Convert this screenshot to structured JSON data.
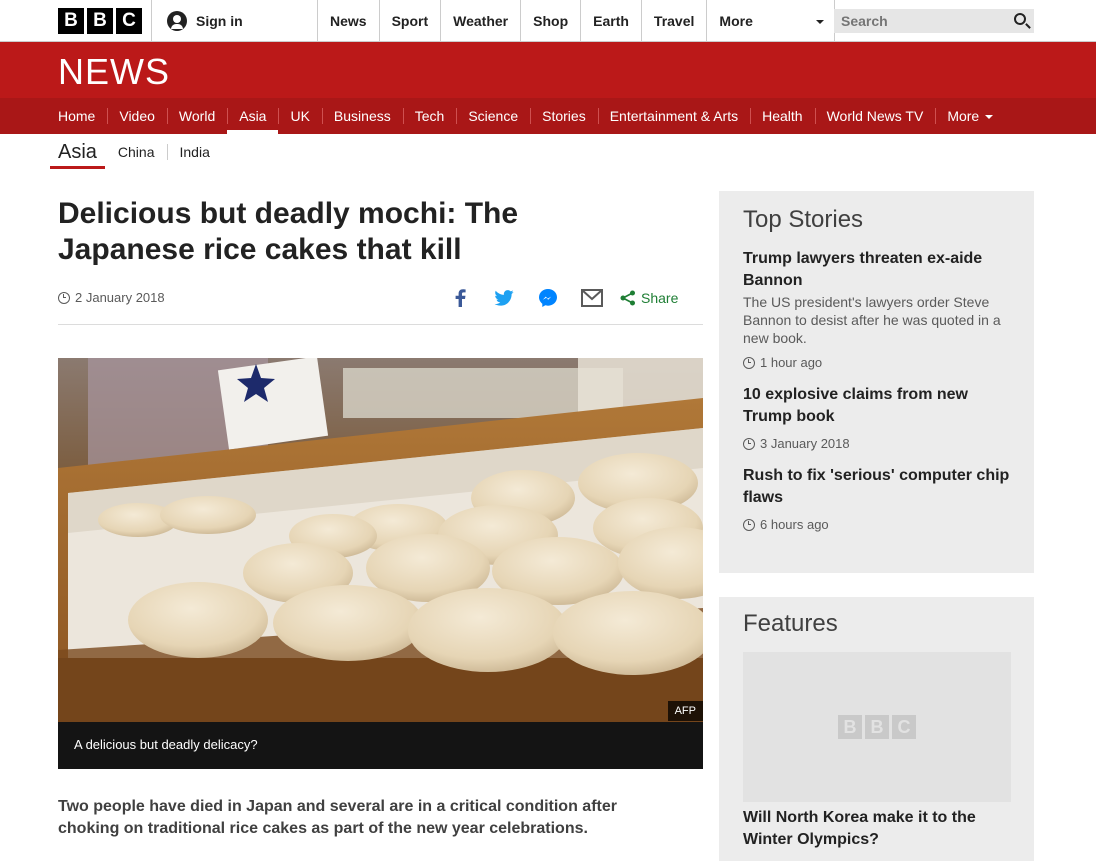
{
  "global": {
    "logo_letters": [
      "B",
      "B",
      "C"
    ],
    "sign_in": "Sign in",
    "nav": [
      "News",
      "Sport",
      "Weather",
      "Shop",
      "Earth",
      "Travel"
    ],
    "more": "More",
    "search_placeholder": "Search"
  },
  "masthead": {
    "wordmark": "NEWS",
    "color": "#bb1919"
  },
  "news_nav": {
    "items": [
      "Home",
      "Video",
      "World",
      "Asia",
      "UK",
      "Business",
      "Tech",
      "Science",
      "Stories",
      "Entertainment & Arts",
      "Health",
      "World News TV"
    ],
    "active": "Asia",
    "more": "More"
  },
  "subnav": {
    "current": "Asia",
    "items": [
      "China",
      "India"
    ]
  },
  "article": {
    "headline": "Delicious but deadly mochi: The Japanese rice cakes that kill",
    "date": "2 January 2018",
    "share_label": "Share",
    "image_credit": "AFP",
    "caption": "A delicious but deadly delicacy?",
    "intro": "Two people have died in Japan and several are in a critical condition after choking on traditional rice cakes as part of the new year celebrations."
  },
  "top_stories": {
    "heading": "Top Stories",
    "items": [
      {
        "title": "Trump lawyers threaten ex-aide Bannon",
        "summary": "The US president's lawyers order Steve Bannon to desist after he was quoted in a new book.",
        "time": "1 hour ago"
      },
      {
        "title": "10 explosive claims from new Trump book",
        "summary": "",
        "time": "3 January 2018"
      },
      {
        "title": "Rush to fix 'serious' computer chip flaws",
        "summary": "",
        "time": "6 hours ago"
      }
    ]
  },
  "features": {
    "heading": "Features",
    "placeholder_letters": [
      "B",
      "B",
      "C"
    ],
    "item_title": "Will North Korea make it to the Winter Olympics?"
  },
  "icons": {
    "facebook": "facebook-icon",
    "twitter": "twitter-icon",
    "messenger": "messenger-icon",
    "email": "email-icon",
    "share": "share-icon",
    "clock": "clock-icon",
    "search": "search-icon",
    "user": "user-icon"
  },
  "colors": {
    "share_green": "#1e7e34",
    "facebook": "#3b5998",
    "twitter": "#1da1f2",
    "messenger": "#0084ff"
  }
}
